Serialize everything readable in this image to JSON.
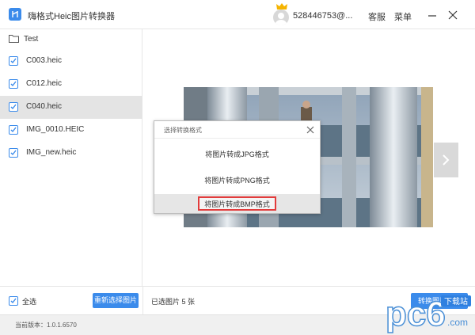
{
  "app": {
    "title": "嗨格式Heic图片转换器",
    "user_name": "528446753@...",
    "service_label": "客服",
    "menu_label": "菜单"
  },
  "sidebar": {
    "folder": "Test",
    "files": [
      {
        "name": "C003.heic",
        "checked": true,
        "selected": false
      },
      {
        "name": "C012.heic",
        "checked": true,
        "selected": false
      },
      {
        "name": "C040.heic",
        "checked": true,
        "selected": true
      },
      {
        "name": "IMG_0010.HEIC",
        "checked": true,
        "selected": false
      },
      {
        "name": "IMG_new.heic",
        "checked": true,
        "selected": false
      }
    ]
  },
  "dialog": {
    "title": "选择转换格式",
    "options": [
      "将图片转成JPG格式",
      "将图片转成PNG格式",
      "将图片转成BMP格式"
    ]
  },
  "bottom": {
    "select_all_label": "全选",
    "reselect_label": "重新选择图片",
    "selected_count": "已选图片 5 张",
    "convert_label": "转换图片格式"
  },
  "footer": {
    "version": "当前版本：1.0.1.6570"
  },
  "watermark": {
    "brand": "pc6",
    "sub": "下载站",
    "url": ".com"
  },
  "colors": {
    "accent": "#3b8beb",
    "highlight": "#e23b3b"
  }
}
